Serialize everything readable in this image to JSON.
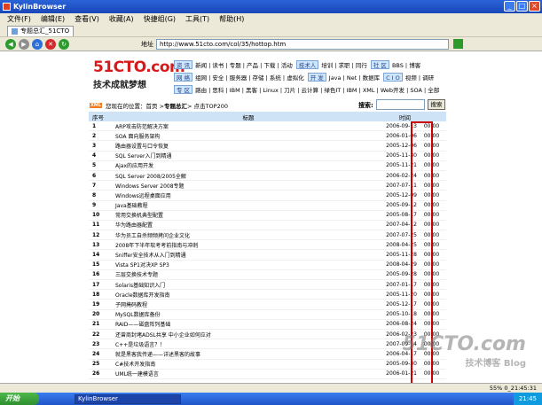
{
  "window": {
    "title": "KylinBrowser"
  },
  "menu": [
    "文件(F)",
    "编辑(E)",
    "查看(V)",
    "收藏(A)",
    "快捷组(G)",
    "工具(T)",
    "帮助(H)"
  ],
  "tab": {
    "label": "专题总汇_51CTO"
  },
  "address": {
    "label": "地址",
    "url": "http://www.51cto.com/col/35/hottop.htm"
  },
  "site": {
    "logo_text": "51CTO.com",
    "slogan": "技术成就梦想",
    "nav_rows": [
      {
        "badge": "资 讯",
        "links": "新闻 | 读书 | 专题 | 产品 | 下载 | 活动",
        "badge2": "技术人",
        "links2": "培训 | 求职 | 同行",
        "badge3": "社 区",
        "links3": "BBS | 博客"
      },
      {
        "badge": "网 络",
        "links": "组网 | 安全 | 服务器 | 存储 | 系统 | 虚拟化",
        "badge2": "开 发",
        "links2": "Java | Net | 数据库",
        "badge3": "C I O",
        "links3": "视频 | 调研"
      },
      {
        "badge": "专 区",
        "links": "路由 | 思科 | IBM | 黑客 | Linux | 刀片 | 云计算 | 绿色IT | IBM | XML | Web开发 | SOA | 全部",
        "badge2": "",
        "links2": "",
        "badge3": "",
        "links3": ""
      }
    ]
  },
  "breadcrumb": {
    "xml": "XML",
    "text": "您现在的位置：首页 > ",
    "current": "专题总汇",
    "tail": " > 点击TOP200"
  },
  "search": {
    "label": "搜索:",
    "button": "搜索"
  },
  "table": {
    "headers": {
      "num": "序号",
      "title": "标题",
      "time": "时间"
    },
    "rows": [
      {
        "n": "1",
        "title": "ARP攻击防范解决方案",
        "date": "2006-09-13",
        "time": "00:00"
      },
      {
        "n": "2",
        "title": "SOA 面向服务架构",
        "date": "2006-01-06",
        "time": "00:00"
      },
      {
        "n": "3",
        "title": "路由器设置与口令恢复",
        "date": "2005-12-06",
        "time": "00:00"
      },
      {
        "n": "4",
        "title": "SQL Server入门到精通",
        "date": "2005-11-30",
        "time": "00:00"
      },
      {
        "n": "5",
        "title": "Ajax的应用开发",
        "date": "2005-11-21",
        "time": "00:00"
      },
      {
        "n": "6",
        "title": "SQL Server 2008/2005全解",
        "date": "2006-02-24",
        "time": "00:00"
      },
      {
        "n": "7",
        "title": "Windows Server 2008专题",
        "date": "2007-07-11",
        "time": "00:00"
      },
      {
        "n": "8",
        "title": "Windows远程桌面应用",
        "date": "2005-12-09",
        "time": "00:00"
      },
      {
        "n": "9",
        "title": "Java基础教程",
        "date": "2005-09-12",
        "time": "00:00"
      },
      {
        "n": "10",
        "title": "常用交换机典型配置",
        "date": "2005-08-17",
        "time": "00:00"
      },
      {
        "n": "11",
        "title": "华为路由器配置",
        "date": "2007-04-12",
        "time": "00:00"
      },
      {
        "n": "12",
        "title": "华为员工自杀频频拷问企业文化",
        "date": "2007-07-25",
        "time": "00:00"
      },
      {
        "n": "13",
        "title": "2008年下半年软考考前指南与冲刺",
        "date": "2008-04-25",
        "time": "00:00"
      },
      {
        "n": "14",
        "title": "Sniffer安全技术从入门到精通",
        "date": "2005-11-28",
        "time": "00:00"
      },
      {
        "n": "15",
        "title": "Vista SP1对决XP SP3",
        "date": "2008-04-29",
        "time": "00:00"
      },
      {
        "n": "16",
        "title": "三层交换技术专题",
        "date": "2005-09-28",
        "time": "00:00"
      },
      {
        "n": "17",
        "title": "Solaris基础知识入门",
        "date": "2007-01-17",
        "time": "00:00"
      },
      {
        "n": "18",
        "title": "Oracle数据库开发指南",
        "date": "2005-11-20",
        "time": "00:00"
      },
      {
        "n": "19",
        "title": "子网掩码教程",
        "date": "2005-12-17",
        "time": "00:00"
      },
      {
        "n": "20",
        "title": "MySQL数据库备份",
        "date": "2005-10-18",
        "time": "00:00"
      },
      {
        "n": "21",
        "title": "RAID——磁盘阵列基础",
        "date": "2006-08-24",
        "time": "00:00"
      },
      {
        "n": "22",
        "title": "还曾商封堵ADSL共享 中小企业如何应对",
        "date": "2006-02-23",
        "time": "00:00"
      },
      {
        "n": "23",
        "title": "C++是垃圾语言？！",
        "date": "2007-09-14",
        "time": "00:00"
      },
      {
        "n": "24",
        "title": "就是黑客我传递——详述黑客的故事",
        "date": "2006-04-17",
        "time": "00:00"
      },
      {
        "n": "25",
        "title": "C#技术开发指南",
        "date": "2005-09-30",
        "time": "00:00"
      },
      {
        "n": "26",
        "title": "UML统一建模语言",
        "date": "2006-01-21",
        "time": "00:00"
      }
    ]
  },
  "watermark": {
    "line1": "51CTO.com",
    "line2": "技术博客 Blog"
  },
  "status": {
    "right": "55%  0_21:45:31"
  },
  "taskbar": {
    "start": "开始",
    "item": "KylinBrowser",
    "clock": "21:45"
  }
}
